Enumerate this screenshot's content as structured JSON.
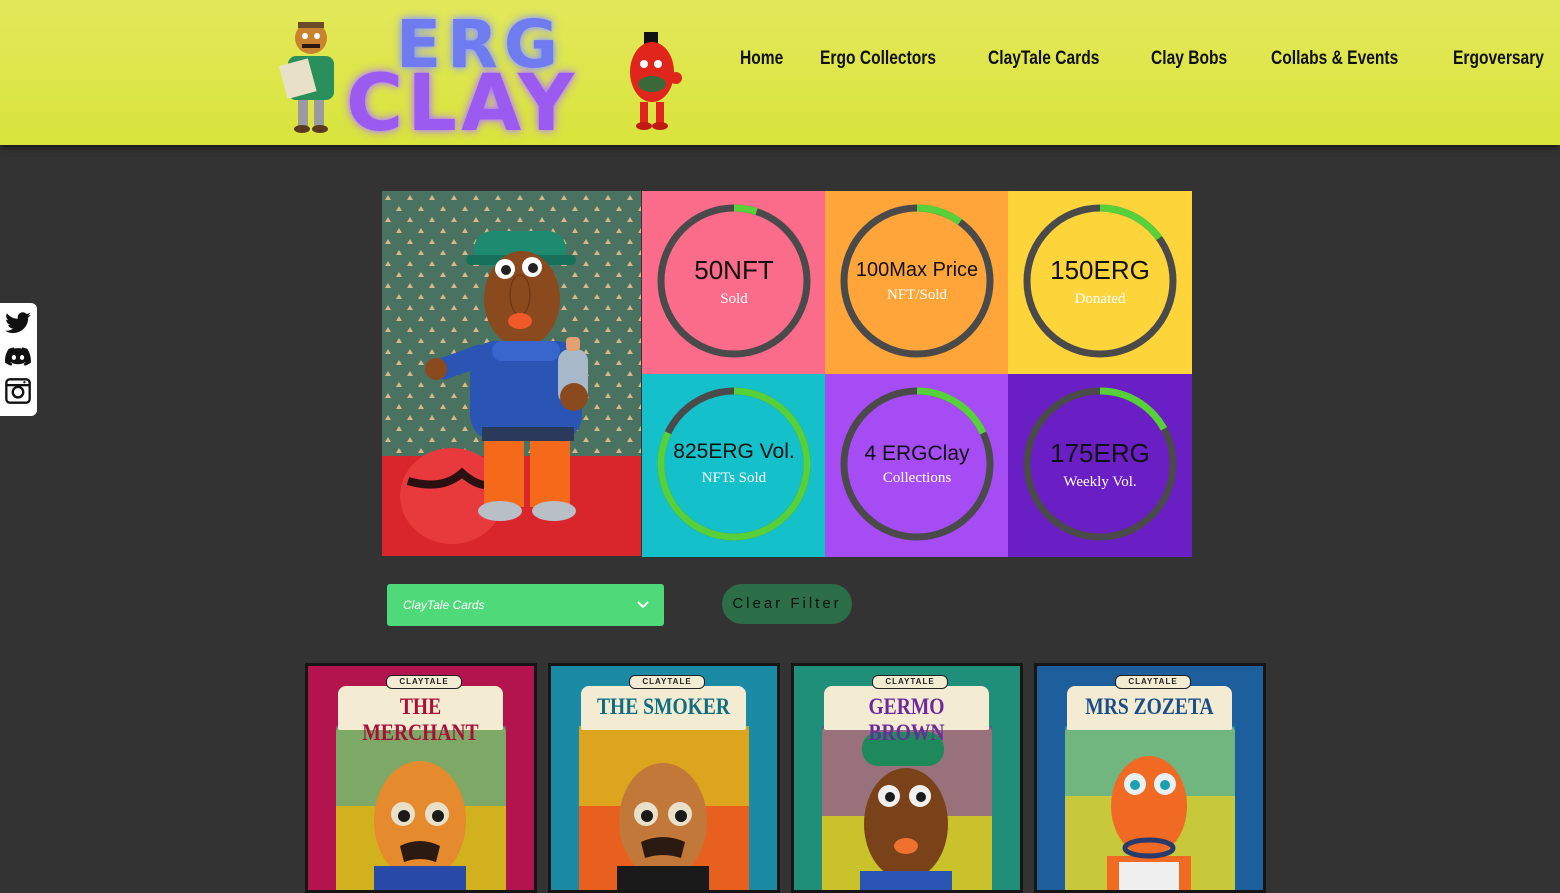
{
  "brand": {
    "logo_line1": "ERG",
    "logo_line2": "CLAY"
  },
  "nav": [
    "Home",
    "Ergo Collectors",
    "ClayTale Cards",
    "Clay Bobs",
    "Collabs & Events",
    "Ergoversary"
  ],
  "social": [
    "twitter-icon",
    "discord-icon",
    "instagram-icon"
  ],
  "stats": [
    {
      "value": "50NFT",
      "label": "Sold",
      "bg": "#fb6c8a",
      "progress": 0.05
    },
    {
      "value": "100Max Price",
      "label": "NFT/Sold",
      "bg": "#ffa53a",
      "progress": 0.1
    },
    {
      "value": "150ERG",
      "label": "Donated",
      "bg": "#fdd53b",
      "progress": 0.15
    },
    {
      "value": "825ERG Vol.",
      "label": "NFTs Sold",
      "bg": "#14c0c9",
      "progress": 0.82
    },
    {
      "value": "4 ERGClay",
      "label": "Collections",
      "bg": "#a64cf5",
      "progress": 0.18
    },
    {
      "value": "175ERG",
      "label": "Weekly Vol.",
      "bg": "#6a1fc4",
      "progress": 0.17
    }
  ],
  "filter": {
    "selected": "ClayTale Cards",
    "clear_label": "Clear Filter"
  },
  "cards": [
    {
      "badge": "CLAYTALE",
      "name": "THE MERCHANT",
      "frame": "#b3144e",
      "name_color": "#a8103a"
    },
    {
      "badge": "CLAYTALE",
      "name": "THE SMOKER",
      "frame": "#1a8aa5",
      "name_color": "#0f6d80"
    },
    {
      "badge": "CLAYTALE",
      "name": "GERMO BROWN",
      "frame": "#1f8f7a",
      "name_color": "#6b2aa0"
    },
    {
      "badge": "CLAYTALE",
      "name": "MRS ZOZETA",
      "frame": "#1d5e9c",
      "name_color": "#1a4d8a"
    }
  ]
}
